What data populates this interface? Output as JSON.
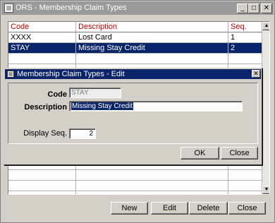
{
  "window": {
    "title": "ORS - Membership Claim Types",
    "controls": {
      "minimize": "_",
      "maximize": "□",
      "close": "✕"
    }
  },
  "grid": {
    "columns": {
      "code": "Code",
      "description": "Description",
      "seq": "Seq."
    },
    "rows": [
      {
        "code": "XXXX",
        "description": "Lost Card",
        "seq": "1",
        "selected": false
      },
      {
        "code": "STAY",
        "description": "Missing Stay Credit",
        "seq": "2",
        "selected": true
      },
      {
        "code": "",
        "description": "",
        "seq": "",
        "selected": false
      },
      {
        "code": "",
        "description": "",
        "seq": "",
        "selected": false
      },
      {
        "code": "",
        "description": "",
        "seq": "",
        "selected": false
      },
      {
        "code": "",
        "description": "",
        "seq": "",
        "selected": false
      },
      {
        "code": "",
        "description": "",
        "seq": "",
        "selected": false
      },
      {
        "code": "",
        "description": "",
        "seq": "",
        "selected": false
      },
      {
        "code": "",
        "description": "",
        "seq": "",
        "selected": false
      },
      {
        "code": "",
        "description": "",
        "seq": "",
        "selected": false
      },
      {
        "code": "",
        "description": "",
        "seq": "",
        "selected": false
      },
      {
        "code": "",
        "description": "",
        "seq": "",
        "selected": false
      },
      {
        "code": "",
        "description": "",
        "seq": "",
        "selected": false
      },
      {
        "code": "",
        "description": "",
        "seq": "",
        "selected": false
      },
      {
        "code": "",
        "description": "",
        "seq": "",
        "selected": false
      },
      {
        "code": "",
        "description": "",
        "seq": "",
        "selected": false
      }
    ],
    "scroll": {
      "up": "▲",
      "down": "▼"
    }
  },
  "buttons": {
    "new": "New",
    "edit": "Edit",
    "delete": "Delete",
    "close": "Close"
  },
  "dialog": {
    "title": "Membership Claim Types - Edit",
    "close_glyph": "✕",
    "fields": {
      "code_label": "Code",
      "code_value": "STAY",
      "description_label": "Description",
      "description_value": "Missing Stay Credit",
      "display_seq_label": "Display Seq.",
      "display_seq_value": "2"
    },
    "buttons": {
      "ok": "OK",
      "close": "Close"
    }
  },
  "colors": {
    "selection": "#0a246a",
    "header_text": "#c00000",
    "face": "#d4d0c8",
    "inactive_title": "#9a9a9a"
  }
}
